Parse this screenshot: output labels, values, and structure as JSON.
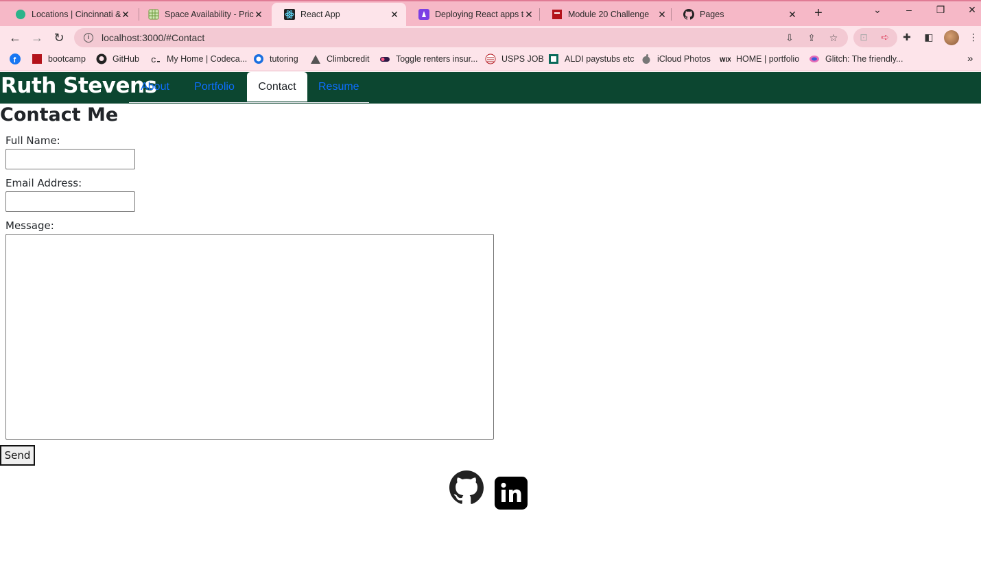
{
  "browser": {
    "tabs": [
      {
        "title": "Locations | Cincinnati &",
        "icon": "green-circle-icon"
      },
      {
        "title": "Space Availability - Price",
        "icon": "spreadsheet-icon"
      },
      {
        "title": "React App",
        "icon": "react-icon"
      },
      {
        "title": "Deploying React apps to",
        "icon": "purple-rocket-icon"
      },
      {
        "title": "Module 20 Challenge",
        "icon": "red-book-icon"
      },
      {
        "title": "Pages",
        "icon": "github-icon"
      }
    ],
    "address": "localhost:3000/#Contact",
    "bookmarks": [
      {
        "label": "bootcamp",
        "icon": "red-folder-icon"
      },
      {
        "label": "GitHub",
        "icon": "github-icon"
      },
      {
        "label": "My Home | Codeca...",
        "icon": "codecademy-icon"
      },
      {
        "label": "tutoring",
        "icon": "blue-c-icon"
      },
      {
        "label": "Climbcredit",
        "icon": "mountain-icon"
      },
      {
        "label": "Toggle renters insur...",
        "icon": "toggle-icon"
      },
      {
        "label": "USPS JOB",
        "icon": "usps-icon"
      },
      {
        "label": "ALDI paystubs etc",
        "icon": "aldi-icon"
      },
      {
        "label": "iCloud Photos",
        "icon": "apple-icon"
      },
      {
        "label": "HOME | portfolio",
        "icon": "wix-icon"
      },
      {
        "label": "Glitch: The friendly...",
        "icon": "glitch-icon"
      }
    ]
  },
  "site": {
    "brand": "Ruth Stevens",
    "nav": [
      "About",
      "Portfolio",
      "Contact",
      "Resume"
    ],
    "active_nav": "Contact"
  },
  "contact": {
    "title": "Contact Me",
    "name_label": "Full Name:",
    "email_label": "Email Address:",
    "message_label": "Message:",
    "name_value": "",
    "email_value": "",
    "message_value": "",
    "send_label": "Send"
  },
  "footer": {
    "icons": [
      "github-icon",
      "linkedin-icon"
    ]
  },
  "colors": {
    "tabbar": "#f6b8c7",
    "toolbar": "#fde4ea",
    "navbar": "#0c4630",
    "link": "#0d6efd"
  }
}
